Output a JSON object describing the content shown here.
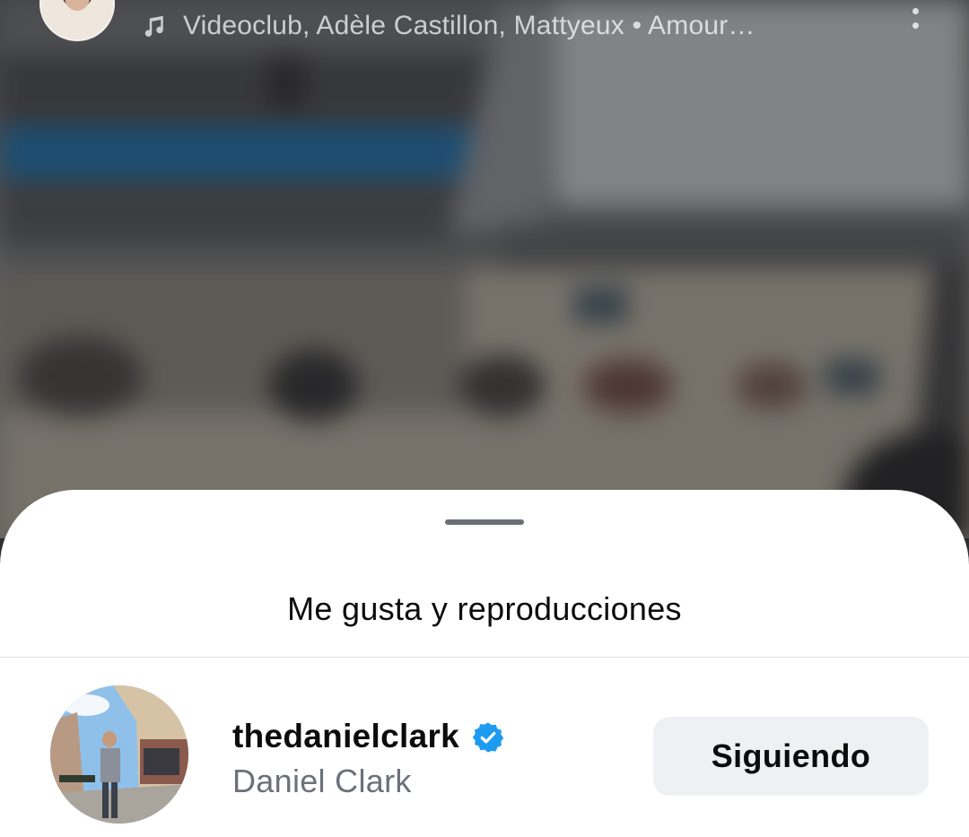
{
  "top_bar": {
    "music_icon": "music-note-icon",
    "audio_text": "Videoclub, Adèle Castillon, Mattyeux • Amour…",
    "more_icon": "more-vertical-icon"
  },
  "sheet": {
    "title": "Me gusta y reproducciones",
    "users": [
      {
        "username": "thedanielclark",
        "full_name": "Daniel Clark",
        "verified": true,
        "button_label": "Siguiendo"
      }
    ]
  },
  "colors": {
    "sheet_bg": "#ffffff",
    "verified_badge": "#1d9bf0",
    "button_bg": "#eff0f3",
    "secondary_text": "#6c7079"
  }
}
